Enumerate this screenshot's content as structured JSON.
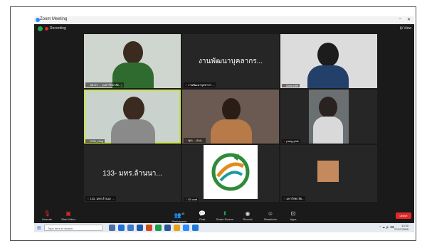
{
  "window": {
    "title": "Zoom Meeting",
    "min": "–",
    "close": "✕"
  },
  "infobar": {
    "recording": "Recording",
    "view": "⊞ View"
  },
  "tiles": [
    {
      "name": "ผศ.ดร. ... (มหาวิทยาลัย...)",
      "big": ""
    },
    {
      "name": "งานพัฒนาบุคลากร ...",
      "big": "งานพัฒนาบุคลากร..."
    },
    {
      "name": "Dear Dell",
      "big": ""
    },
    {
      "name": "CSD_Ning",
      "big": ""
    },
    {
      "name": "คุณ... (Sci)...",
      "big": ""
    },
    {
      "name": "pang-pink",
      "big": ""
    },
    {
      "name": "133- มทร.ล้านนา ...",
      "big": "133- มทร.ล้านนา..."
    },
    {
      "name": "ID card",
      "big": ""
    },
    {
      "name": "มหาวิทยาลัย...",
      "big": ""
    }
  ],
  "toolbar": {
    "mute": "Unmute",
    "video": "Start Video",
    "participants": "Participants",
    "participants_count": "45",
    "chat": "Chat",
    "share": "Share Screen",
    "record": "Record",
    "reactions": "Reactions",
    "apps": "Apps",
    "leave": "Leave"
  },
  "taskbar": {
    "search_placeholder": "Type here to search",
    "time": "10:30",
    "date": "27/07/2565"
  }
}
